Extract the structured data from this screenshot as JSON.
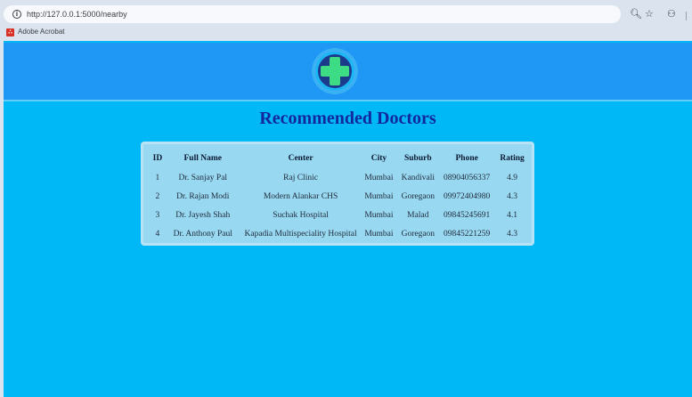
{
  "browser": {
    "url": "http://127.0.0.1:5000/nearby",
    "bookmarks": [
      {
        "label": "Adobe Acrobat"
      }
    ]
  },
  "page": {
    "title": "Recommended Doctors",
    "colors": {
      "background": "#01b8f6",
      "header": "#1f97f4",
      "title": "#12289e",
      "logo_cross": "#3ddc84"
    }
  },
  "table": {
    "columns": [
      "ID",
      "Full Name",
      "Center",
      "City",
      "Suburb",
      "Phone",
      "Rating"
    ],
    "rows": [
      [
        "1",
        "Dr. Sanjay Pal",
        "Raj Clinic",
        "Mumbai",
        "Kandivali",
        "08904056337",
        "4.9"
      ],
      [
        "2",
        "Dr. Rajan Modi",
        "Modern Alankar CHS",
        "Mumbai",
        "Goregaon",
        "09972404980",
        "4.3"
      ],
      [
        "3",
        "Dr. Jayesh Shah",
        "Suchak Hospital",
        "Mumbai",
        "Malad",
        "09845245691",
        "4.1"
      ],
      [
        "4",
        "Dr. Anthony Paul",
        "Kapadia Multispeciality Hospital",
        "Mumbai",
        "Goregaon",
        "09845221259",
        "4.3"
      ]
    ]
  }
}
